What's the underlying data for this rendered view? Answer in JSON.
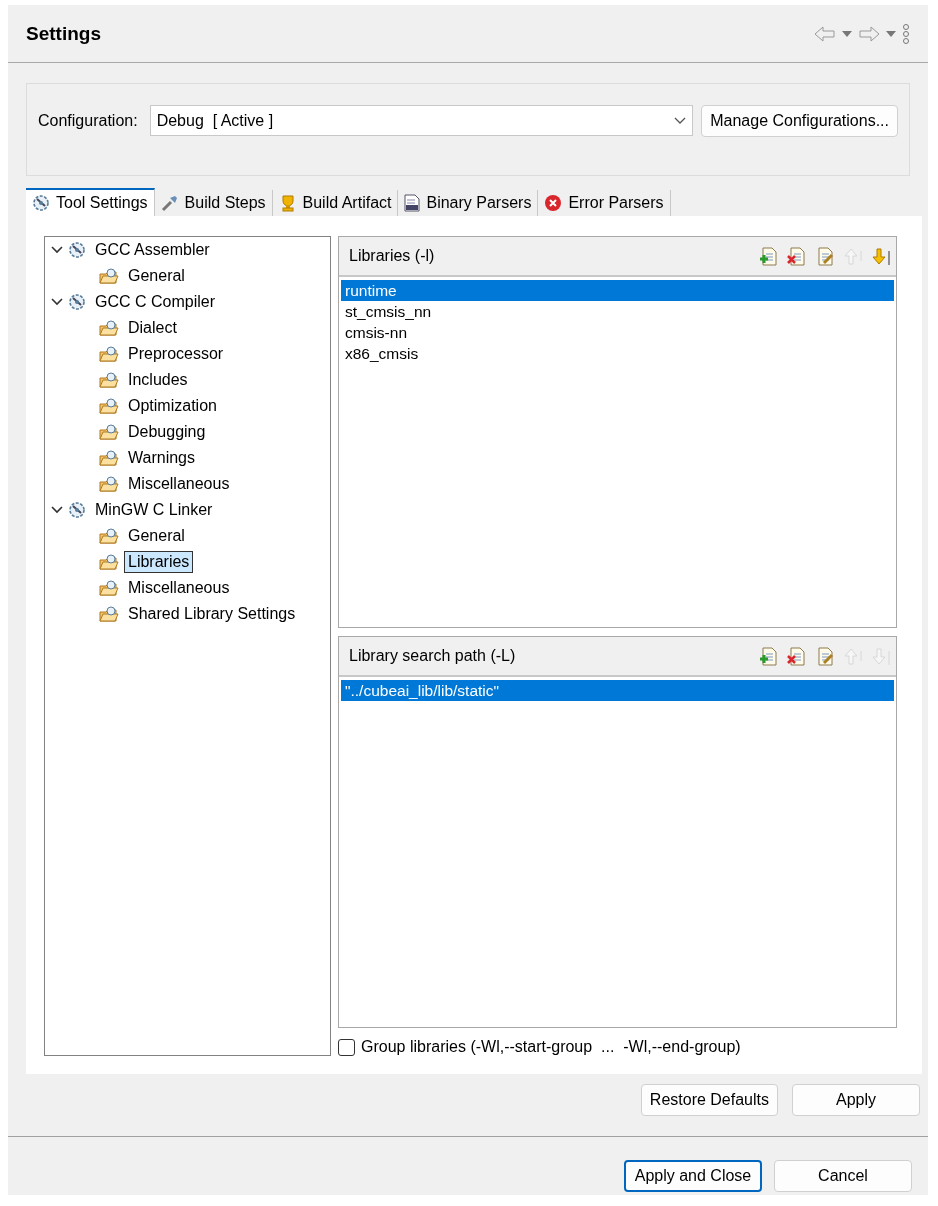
{
  "window": {
    "title": "Settings"
  },
  "configuration": {
    "label": "Configuration:",
    "value": "Debug  [ Active ]",
    "button": "Manage Configurations..."
  },
  "tabs": [
    {
      "label": "Tool Settings",
      "kind": "tool",
      "selected": true
    },
    {
      "label": "Build Steps",
      "kind": "steps",
      "selected": false
    },
    {
      "label": "Build Artifact",
      "kind": "artifact",
      "selected": false
    },
    {
      "label": "Binary Parsers",
      "kind": "binary",
      "selected": false
    },
    {
      "label": "Error Parsers",
      "kind": "error",
      "selected": false
    }
  ],
  "tree": [
    {
      "label": "GCC Assembler",
      "kind": "tool",
      "expanded": true,
      "selected": false,
      "children": [
        {
          "label": "General",
          "kind": "category",
          "selected": false
        }
      ]
    },
    {
      "label": "GCC C Compiler",
      "kind": "tool",
      "expanded": true,
      "selected": false,
      "children": [
        {
          "label": "Dialect",
          "kind": "category",
          "selected": false
        },
        {
          "label": "Preprocessor",
          "kind": "category",
          "selected": false
        },
        {
          "label": "Includes",
          "kind": "category",
          "selected": false
        },
        {
          "label": "Optimization",
          "kind": "category",
          "selected": false
        },
        {
          "label": "Debugging",
          "kind": "category",
          "selected": false
        },
        {
          "label": "Warnings",
          "kind": "category",
          "selected": false
        },
        {
          "label": "Miscellaneous",
          "kind": "category",
          "selected": false
        }
      ]
    },
    {
      "label": "MinGW C Linker",
      "kind": "tool",
      "expanded": true,
      "selected": false,
      "children": [
        {
          "label": "General",
          "kind": "category",
          "selected": false
        },
        {
          "label": "Libraries",
          "kind": "category",
          "selected": true
        },
        {
          "label": "Miscellaneous",
          "kind": "category",
          "selected": false
        },
        {
          "label": "Shared Library Settings",
          "kind": "category",
          "selected": false
        }
      ]
    }
  ],
  "lists": [
    {
      "title": "Libraries (-l)",
      "tools": [
        {
          "kind": "add",
          "disabled": false
        },
        {
          "kind": "delete",
          "disabled": false
        },
        {
          "kind": "edit",
          "disabled": false
        },
        {
          "kind": "up",
          "disabled": true
        },
        {
          "kind": "down",
          "disabled": false
        }
      ],
      "items": [
        {
          "text": "runtime",
          "selected": true
        },
        {
          "text": "st_cmsis_nn",
          "selected": false
        },
        {
          "text": "cmsis-nn",
          "selected": false
        },
        {
          "text": "x86_cmsis",
          "selected": false
        }
      ]
    },
    {
      "title": "Library search path (-L)",
      "tools": [
        {
          "kind": "add",
          "disabled": false
        },
        {
          "kind": "delete",
          "disabled": false
        },
        {
          "kind": "edit",
          "disabled": false
        },
        {
          "kind": "up",
          "disabled": true
        },
        {
          "kind": "down",
          "disabled": true
        }
      ],
      "items": [
        {
          "text": "\"../cubeai_lib/lib/static\"",
          "selected": true
        }
      ]
    }
  ],
  "group_libraries": {
    "label": "Group libraries (-Wl,--start-group  ...  -Wl,--end-group)",
    "checked": false
  },
  "page_buttons": [
    {
      "label": "Restore Defaults",
      "default": false
    },
    {
      "label": "Apply",
      "default": false
    }
  ],
  "dialog_buttons": [
    {
      "label": "Apply and Close",
      "default": true
    },
    {
      "label": "Cancel",
      "default": false
    }
  ]
}
